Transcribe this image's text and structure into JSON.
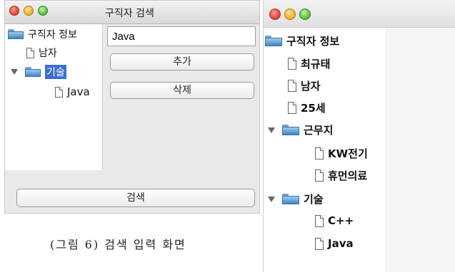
{
  "left_window": {
    "title": "구직자 검색",
    "tree": [
      {
        "label": "구직자 정보",
        "type": "folder"
      },
      {
        "label": "남자",
        "type": "file"
      },
      {
        "label": "기술",
        "type": "folder",
        "expanded": true,
        "selected": true
      },
      {
        "label": "Java",
        "type": "file"
      }
    ],
    "search_input_value": "Java",
    "add_button": "추가",
    "delete_button": "삭제",
    "search_button": "검색"
  },
  "caption": "(그림 6) 검색 입력 화면",
  "right_window": {
    "tree": [
      {
        "label": "구직자 정보",
        "type": "folder"
      },
      {
        "label": "최규태",
        "type": "file"
      },
      {
        "label": "남자",
        "type": "file"
      },
      {
        "label": "25세",
        "type": "file"
      },
      {
        "label": "근무지",
        "type": "folder",
        "expanded": true
      },
      {
        "label": "KW전기",
        "type": "file"
      },
      {
        "label": "휴먼의료",
        "type": "file"
      },
      {
        "label": "기술",
        "type": "folder",
        "expanded": true
      },
      {
        "label": "C++",
        "type": "file"
      },
      {
        "label": "Java",
        "type": "file"
      }
    ]
  }
}
